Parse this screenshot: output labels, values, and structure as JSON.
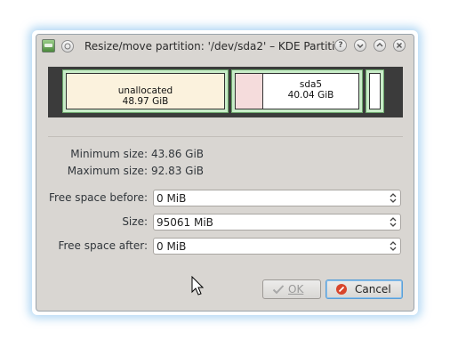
{
  "window": {
    "title": "Resize/move partition: '/dev/sda2' – KDE Partiti...",
    "help_glyph": "?"
  },
  "partitions": {
    "unallocated": {
      "name": "unallocated",
      "size": "48.97 GiB"
    },
    "sda5": {
      "name": "sda5",
      "size": "40.04 GiB"
    }
  },
  "info": {
    "min_label": "Minimum size:",
    "min_value": "43.86 GiB",
    "max_label": "Maximum size:",
    "max_value": "92.83 GiB"
  },
  "fields": {
    "free_before": {
      "label": "Free space before:",
      "value": "0 MiB"
    },
    "size": {
      "label": "Size:",
      "value": "95061 MiB"
    },
    "free_after": {
      "label": "Free space after:",
      "value": "0 MiB"
    }
  },
  "buttons": {
    "ok": "OK",
    "cancel": "Cancel"
  },
  "colors": {
    "partition_fill": "#c8ecc8",
    "unallocated_fill": "#fbf2dd",
    "used_fill": "#f5dcdc",
    "window_bg": "#d9d6d2"
  }
}
